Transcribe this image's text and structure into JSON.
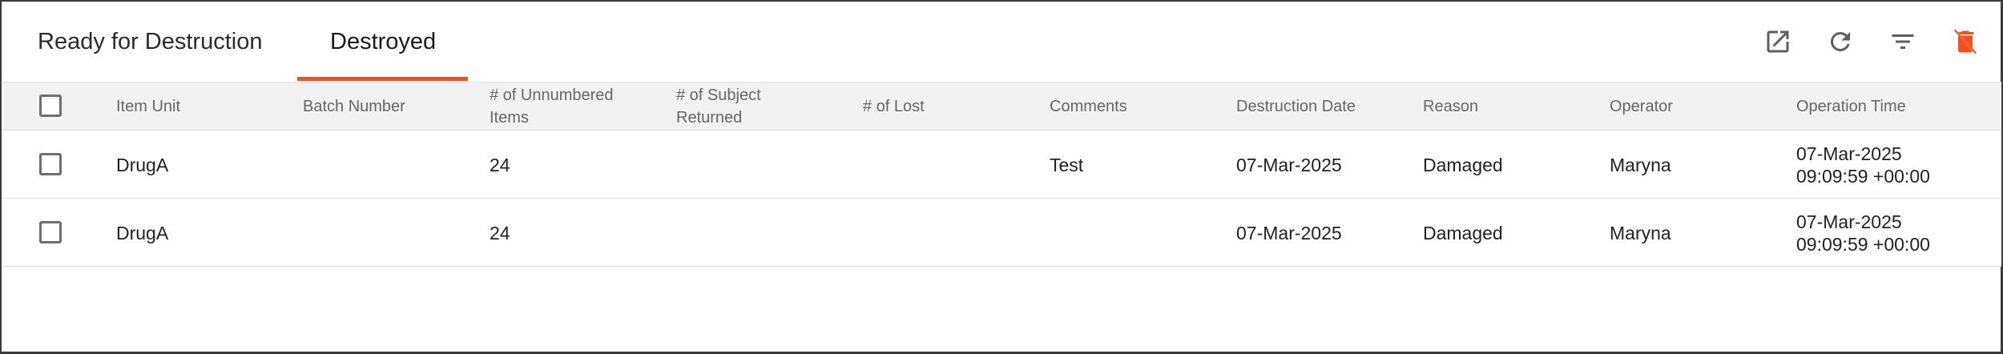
{
  "tabs": [
    {
      "label": "Ready for Destruction",
      "active": false
    },
    {
      "label": "Destroyed",
      "active": true
    }
  ],
  "accent_color": "#f4511e",
  "toolbar": {
    "icons": [
      "open-in-new-icon",
      "refresh-icon",
      "filter-icon",
      "delete-disabled-icon"
    ]
  },
  "table": {
    "columns": [
      "Item Unit",
      "Batch Number",
      "# of Unnumbered Items",
      "# of Subject Returned",
      "# of Lost",
      "Comments",
      "Destruction Date",
      "Reason",
      "Operator",
      "Operation Time"
    ],
    "header_wrapped": {
      "unnumbered_line1": "# of Unnumbered",
      "unnumbered_line2": "Items",
      "subject_line1": "# of Subject",
      "subject_line2": "Returned"
    },
    "rows": [
      {
        "item_unit": "DrugA",
        "batch_number": "",
        "unnumbered_items": "24",
        "subject_returned": "",
        "lost": "",
        "comments": "Test",
        "destruction_date": "07-Mar-2025",
        "reason": "Damaged",
        "operator": "Maryna",
        "operation_time_date": "07-Mar-2025",
        "operation_time_time": "09:09:59 +00:00"
      },
      {
        "item_unit": "DrugA",
        "batch_number": "",
        "unnumbered_items": "24",
        "subject_returned": "",
        "lost": "",
        "comments": "",
        "destruction_date": "07-Mar-2025",
        "reason": "Damaged",
        "operator": "Maryna",
        "operation_time_date": "07-Mar-2025",
        "operation_time_time": "09:09:59 +00:00"
      }
    ]
  }
}
